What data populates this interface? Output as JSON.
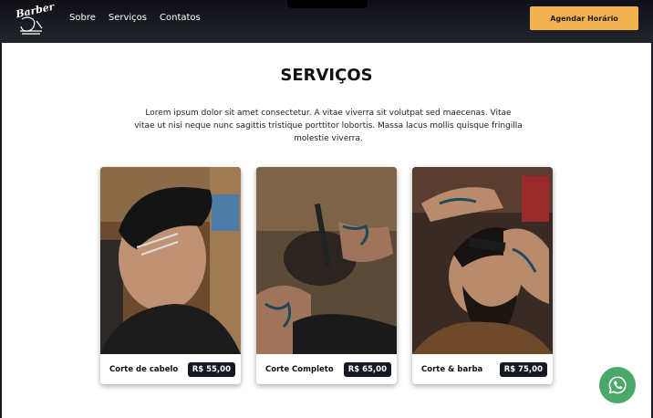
{
  "header": {
    "logo_text": "Barber",
    "nav": [
      "Sobre",
      "Serviços",
      "Contatos"
    ],
    "cta": "Agendar Horário"
  },
  "section": {
    "title": "SERVIÇOS",
    "description": "Lorem ipsum dolor sit amet consectetur. A vitae viverra sit volutpat sed maecenas. Vitae vitae ut nisi neque nunc sagittis tristique porttitor lobortis. Massa lacus mollis quisque fringilla molestie viverra."
  },
  "services": [
    {
      "name": "Corte de cabelo",
      "price": "R$ 55,00"
    },
    {
      "name": "Corte Completo",
      "price": "R$ 65,00"
    },
    {
      "name": "Corte & barba",
      "price": "R$ 75,00"
    }
  ],
  "colors": {
    "accent": "#f2b24f",
    "dark": "#161823",
    "whatsapp": "#4aa86b"
  },
  "icons": {
    "whatsapp": "whatsapp-icon",
    "logo": "barber-logo-icon"
  }
}
